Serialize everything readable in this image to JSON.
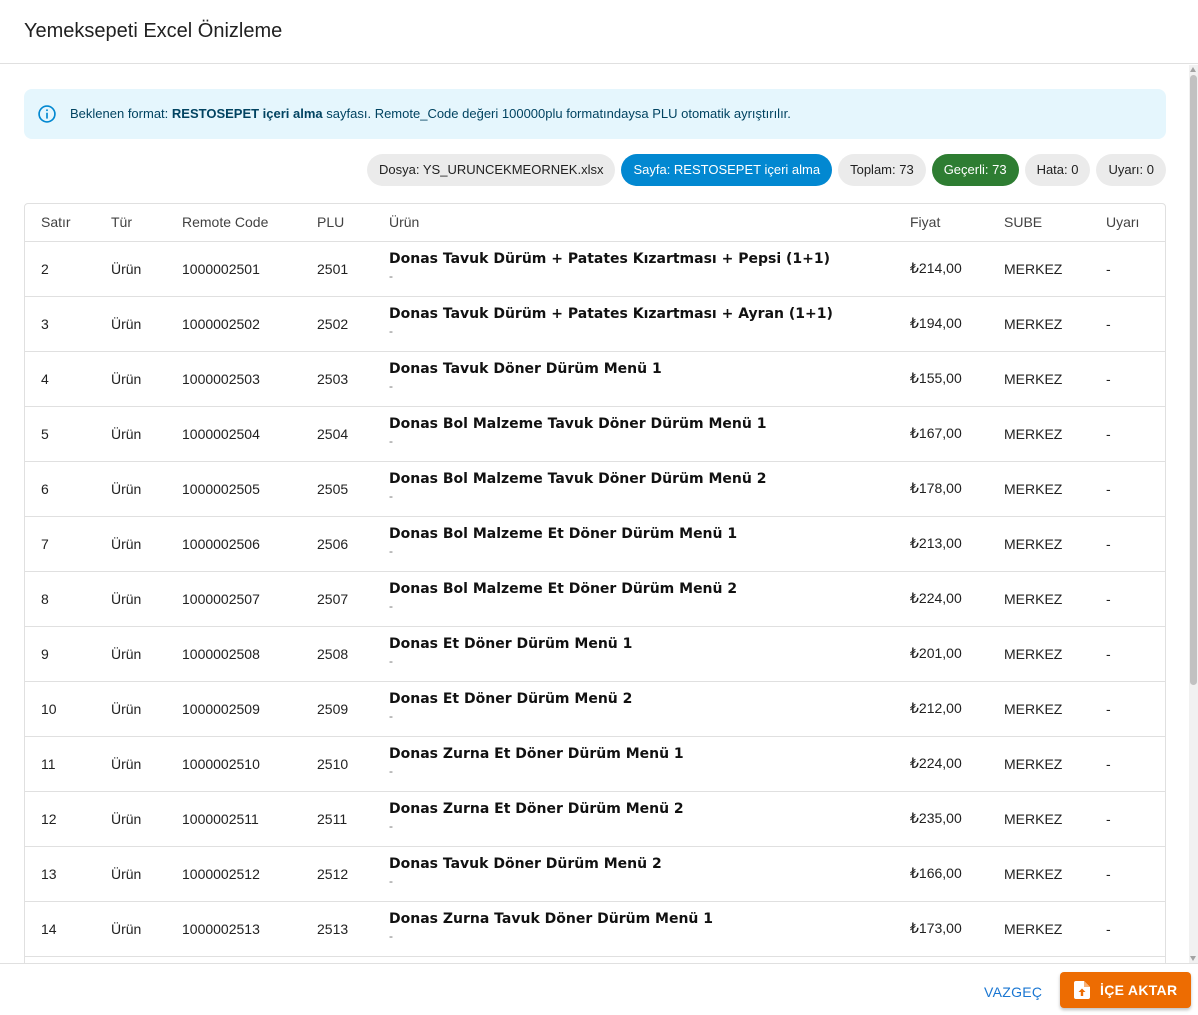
{
  "dialog": {
    "title": "Yemeksepeti Excel Önizleme"
  },
  "alert": {
    "prefix": "Beklenen format: ",
    "bold": "RESTOSEPET içeri alma",
    "suffix": " sayfası. Remote_Code değeri 100000plu formatındaysa PLU otomatik ayrıştırılır.",
    "icon": "info-icon"
  },
  "chips": {
    "file": "Dosya: YS_URUNCEKMEORNEK.xlsx",
    "sheet": "Sayfa: RESTOSEPET içeri alma",
    "total": "Toplam: 73",
    "valid": "Geçerli: 73",
    "error": "Hata: 0",
    "warning": "Uyarı: 0"
  },
  "colors": {
    "info": "#0288d1",
    "success": "#2e7d32",
    "warning": "#ed6c02",
    "primary": "#1976d2"
  },
  "table": {
    "headers": [
      "Satır",
      "Tür",
      "Remote Code",
      "PLU",
      "Ürün",
      "Fiyat",
      "SUBE",
      "Uyarı"
    ],
    "rows": [
      {
        "row": "2",
        "type": "Ürün",
        "remote": "1000002501",
        "plu": "2501",
        "name": "Donas Tavuk Dürüm + Patates Kızartması + Pepsi (1+1)",
        "sub": "-",
        "price": "₺214,00",
        "branch": "MERKEZ",
        "warn": "-"
      },
      {
        "row": "3",
        "type": "Ürün",
        "remote": "1000002502",
        "plu": "2502",
        "name": "Donas Tavuk Dürüm + Patates Kızartması + Ayran (1+1)",
        "sub": "-",
        "price": "₺194,00",
        "branch": "MERKEZ",
        "warn": "-"
      },
      {
        "row": "4",
        "type": "Ürün",
        "remote": "1000002503",
        "plu": "2503",
        "name": "Donas Tavuk Döner Dürüm Menü 1",
        "sub": "-",
        "price": "₺155,00",
        "branch": "MERKEZ",
        "warn": "-"
      },
      {
        "row": "5",
        "type": "Ürün",
        "remote": "1000002504",
        "plu": "2504",
        "name": "Donas Bol Malzeme Tavuk Döner Dürüm Menü 1",
        "sub": "-",
        "price": "₺167,00",
        "branch": "MERKEZ",
        "warn": "-"
      },
      {
        "row": "6",
        "type": "Ürün",
        "remote": "1000002505",
        "plu": "2505",
        "name": "Donas Bol Malzeme Tavuk Döner Dürüm Menü 2",
        "sub": "-",
        "price": "₺178,00",
        "branch": "MERKEZ",
        "warn": "-"
      },
      {
        "row": "7",
        "type": "Ürün",
        "remote": "1000002506",
        "plu": "2506",
        "name": "Donas Bol Malzeme Et Döner Dürüm Menü 1",
        "sub": "-",
        "price": "₺213,00",
        "branch": "MERKEZ",
        "warn": "-"
      },
      {
        "row": "8",
        "type": "Ürün",
        "remote": "1000002507",
        "plu": "2507",
        "name": "Donas Bol Malzeme Et Döner Dürüm Menü 2",
        "sub": "-",
        "price": "₺224,00",
        "branch": "MERKEZ",
        "warn": "-"
      },
      {
        "row": "9",
        "type": "Ürün",
        "remote": "1000002508",
        "plu": "2508",
        "name": "Donas Et Döner Dürüm Menü 1",
        "sub": "-",
        "price": "₺201,00",
        "branch": "MERKEZ",
        "warn": "-"
      },
      {
        "row": "10",
        "type": "Ürün",
        "remote": "1000002509",
        "plu": "2509",
        "name": "Donas Et Döner Dürüm Menü 2",
        "sub": "-",
        "price": "₺212,00",
        "branch": "MERKEZ",
        "warn": "-"
      },
      {
        "row": "11",
        "type": "Ürün",
        "remote": "1000002510",
        "plu": "2510",
        "name": "Donas Zurna Et Döner Dürüm Menü 1",
        "sub": "-",
        "price": "₺224,00",
        "branch": "MERKEZ",
        "warn": "-"
      },
      {
        "row": "12",
        "type": "Ürün",
        "remote": "1000002511",
        "plu": "2511",
        "name": "Donas Zurna Et Döner Dürüm Menü 2",
        "sub": "-",
        "price": "₺235,00",
        "branch": "MERKEZ",
        "warn": "-"
      },
      {
        "row": "13",
        "type": "Ürün",
        "remote": "1000002512",
        "plu": "2512",
        "name": "Donas Tavuk Döner Dürüm Menü 2",
        "sub": "-",
        "price": "₺166,00",
        "branch": "MERKEZ",
        "warn": "-"
      },
      {
        "row": "14",
        "type": "Ürün",
        "remote": "1000002513",
        "plu": "2513",
        "name": "Donas Zurna Tavuk Döner Dürüm Menü 1",
        "sub": "-",
        "price": "₺173,00",
        "branch": "MERKEZ",
        "warn": "-"
      }
    ]
  },
  "actions": {
    "cancel": "VAZGEÇ",
    "import": "İÇE AKTAR",
    "import_icon": "upload-file-icon"
  }
}
